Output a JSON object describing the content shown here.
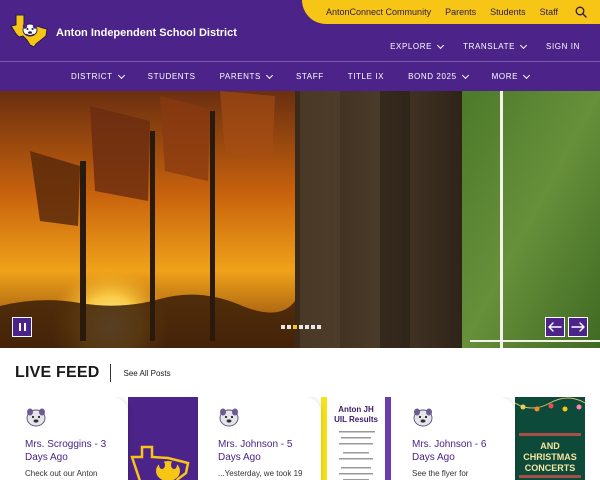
{
  "header": {
    "district_name": "Anton Independent School District",
    "utility_links": [
      "AntonConnect Community",
      "Parents",
      "Students",
      "Staff"
    ],
    "secondary_nav": [
      {
        "label": "EXPLORE",
        "has_dropdown": true
      },
      {
        "label": "TRANSLATE",
        "has_dropdown": true
      },
      {
        "label": "SIGN IN",
        "has_dropdown": false
      }
    ],
    "main_nav": [
      {
        "label": "DISTRICT",
        "has_dropdown": true
      },
      {
        "label": "STUDENTS",
        "has_dropdown": false
      },
      {
        "label": "PARENTS",
        "has_dropdown": true
      },
      {
        "label": "STAFF",
        "has_dropdown": false
      },
      {
        "label": "TITLE IX",
        "has_dropdown": false
      },
      {
        "label": "BOND 2025",
        "has_dropdown": true
      },
      {
        "label": "MORE",
        "has_dropdown": true
      }
    ]
  },
  "hero": {
    "slide_count": 7,
    "active_slide": 3
  },
  "live_feed": {
    "title": "LIVE FEED",
    "see_all": "See All Posts",
    "posts": [
      {
        "author": "Mrs. Scroggins - 3 Days Ago",
        "text": "Check out our Anton",
        "image": "anton-bulldog-logo"
      },
      {
        "author": "Mrs. Johnson - 5 Days Ago",
        "text": "...Yesterday, we took 19",
        "image_title": "Anton JH UIL Results"
      },
      {
        "author": "Mrs. Johnson - 6 Days Ago",
        "text": "See the flyer for",
        "image_title": "AND CHRISTMAS CONCERTS"
      }
    ]
  },
  "colors": {
    "brand_purple": "#4b2389",
    "brand_gold": "#f6c515"
  }
}
